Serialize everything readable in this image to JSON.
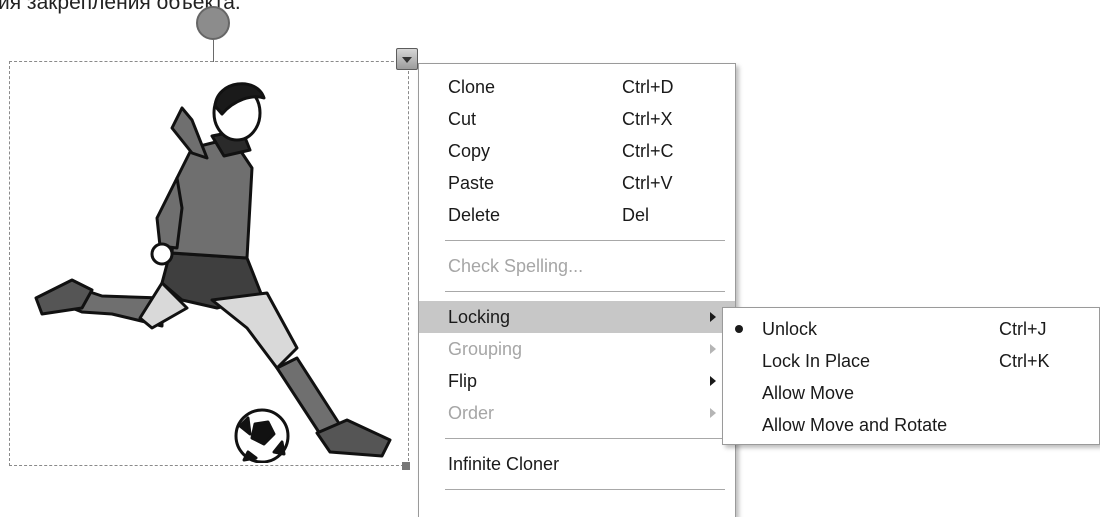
{
  "caption": "ия закрепления объекта.",
  "context_menu": {
    "items_group1": [
      {
        "label": "Clone",
        "shortcut": "Ctrl+D"
      },
      {
        "label": "Cut",
        "shortcut": "Ctrl+X"
      },
      {
        "label": "Copy",
        "shortcut": "Ctrl+C"
      },
      {
        "label": "Paste",
        "shortcut": "Ctrl+V"
      },
      {
        "label": "Delete",
        "shortcut": "Del"
      }
    ],
    "check_spelling": "Check Spelling...",
    "items_group3": [
      {
        "label": "Locking"
      },
      {
        "label": "Grouping"
      },
      {
        "label": "Flip"
      },
      {
        "label": "Order"
      }
    ],
    "infinite_cloner": "Infinite Cloner"
  },
  "locking_submenu": {
    "items": [
      {
        "label": "Unlock",
        "shortcut": "Ctrl+J",
        "selected": true
      },
      {
        "label": "Lock In Place",
        "shortcut": "Ctrl+K"
      },
      {
        "label": "Allow Move",
        "shortcut": ""
      },
      {
        "label": "Allow Move and Rotate",
        "shortcut": ""
      }
    ]
  },
  "colors": {
    "highlight": "#c7c7c7",
    "disabled_text": "#a6a6a6",
    "selection_border": "#8a8a8a"
  }
}
